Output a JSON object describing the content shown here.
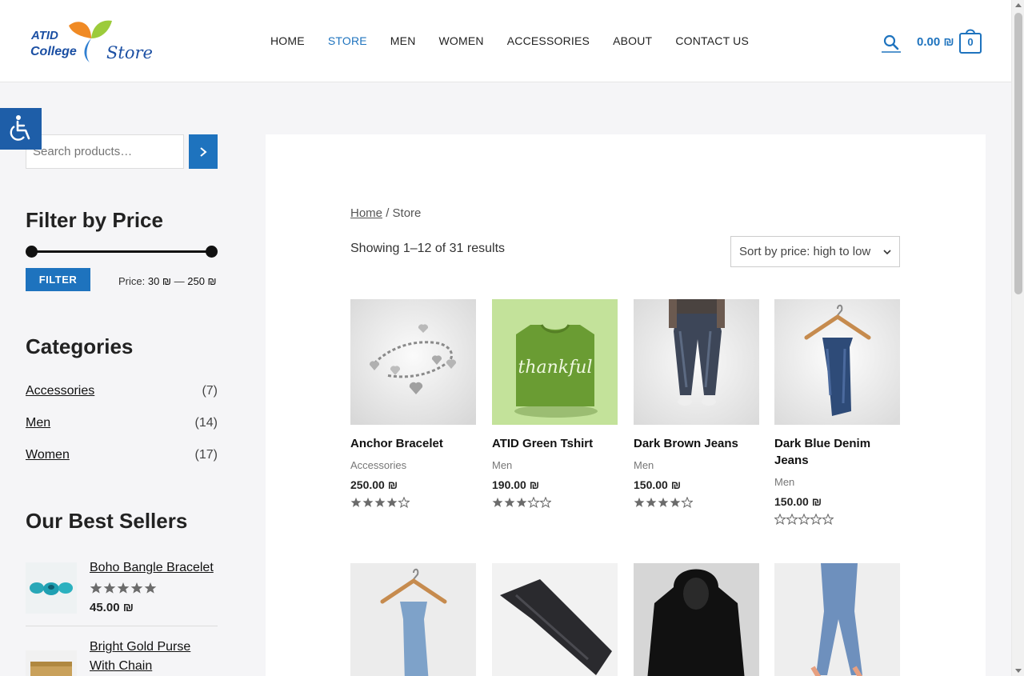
{
  "header": {
    "logo": {
      "line1": "ATID",
      "line2": "College",
      "line3": "Store"
    },
    "nav": [
      {
        "label": "HOME",
        "active": false
      },
      {
        "label": "STORE",
        "active": true
      },
      {
        "label": "MEN",
        "active": false
      },
      {
        "label": "WOMEN",
        "active": false
      },
      {
        "label": "ACCESSORIES",
        "active": false
      },
      {
        "label": "ABOUT",
        "active": false
      },
      {
        "label": "CONTACT US",
        "active": false
      }
    ],
    "cart_total": "0.00 ₪",
    "cart_count": "0",
    "search_icon": "search-icon",
    "cart_icon": "shopping-bag-icon"
  },
  "accessibility_icon": "wheelchair-icon",
  "sidebar": {
    "search": {
      "placeholder": "Search products…"
    },
    "filter": {
      "title": "Filter by Price",
      "button": "FILTER",
      "price_label": "Price:",
      "min": "30 ₪",
      "dash": "—",
      "max": "250 ₪"
    },
    "categories": {
      "title": "Categories",
      "items": [
        {
          "name": "Accessories",
          "count": "(7)"
        },
        {
          "name": "Men",
          "count": "(14)"
        },
        {
          "name": "Women",
          "count": "(17)"
        }
      ]
    },
    "best_sellers": {
      "title": "Our Best Sellers",
      "items": [
        {
          "name": "Boho Bangle Bracelet",
          "price": "45.00 ₪",
          "rating": 5
        },
        {
          "name": "Bright Gold Purse With Chain",
          "price": "",
          "rating": 0
        }
      ]
    }
  },
  "main": {
    "breadcrumb": {
      "home": "Home",
      "sep": "/",
      "current": "Store"
    },
    "results": "Showing 1–12 of 31 results",
    "sort": "Sort by price: high to low",
    "products": [
      {
        "name": "Anchor Bracelet",
        "category": "Accessories",
        "price": "250.00 ₪",
        "rating": 4
      },
      {
        "name": "ATID Green Tshirt",
        "category": "Men",
        "price": "190.00 ₪",
        "rating": 3,
        "print": "thankful"
      },
      {
        "name": "Dark Brown Jeans",
        "category": "Men",
        "price": "150.00 ₪",
        "rating": 4
      },
      {
        "name": "Dark Blue Denim Jeans",
        "category": "Men",
        "price": "150.00 ₪",
        "rating": 0
      }
    ]
  },
  "colors": {
    "accent": "#1e73be",
    "page_bg": "#f5f5f7"
  }
}
